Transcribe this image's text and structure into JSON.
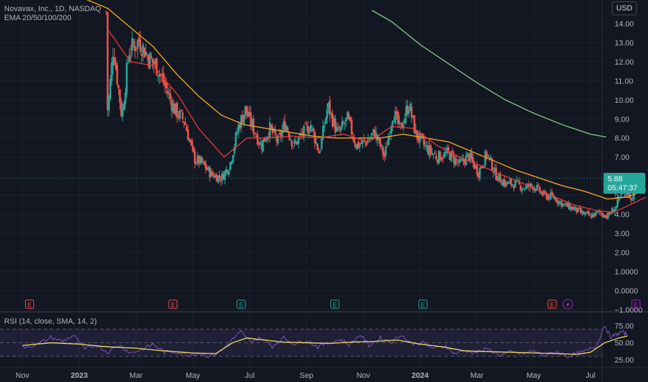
{
  "header": {
    "symbol_line": "Novavax, Inc., 1D, NASDAQ",
    "indicator_line": "EMA 20/50/100/200",
    "currency_button": "USD"
  },
  "rsi_panel": {
    "label": "RSI (14, close, SMA, 14, 2)"
  },
  "price_tag": {
    "price": "5.88",
    "countdown": "05:47:37"
  },
  "colors": {
    "background": "#131722",
    "up": "#26a69a",
    "down": "#ef5350",
    "ema20": "#e53935",
    "ema50": "#f5a623",
    "ema200": "#81c784",
    "rsi": "#7e57c2",
    "rsi_ma": "#e6d55a",
    "grid": "#1e222d"
  },
  "chart_data": [
    {
      "type": "candlestick",
      "title": "Novavax, Inc., 1D, NASDAQ",
      "y_ticks": [
        "14.00",
        "13.00",
        "12.00",
        "11.00",
        "10.00",
        "9.00",
        "8.00",
        "7.00",
        "6.00",
        "5.00",
        "4.00",
        "3.00",
        "2.00",
        "1.0000",
        "0.0000",
        "−1.0000"
      ],
      "ylim": [
        -1.0,
        14.7
      ],
      "x_ticks": [
        "Nov",
        "2023",
        "Mar",
        "May",
        "Jul",
        "Sep",
        "Nov",
        "2024",
        "Mar",
        "May",
        "Jul"
      ],
      "bold_x_ticks": [
        "2023",
        "2024"
      ],
      "x_tick_months": [
        0,
        2,
        4,
        6,
        8,
        10,
        12,
        14,
        16,
        18,
        20
      ],
      "xlim_months": [
        -0.4,
        20.8
      ],
      "legend": "EMA 20/50/100/200",
      "grid": true,
      "price_anchors": [
        [
          2.95,
          14.6
        ],
        [
          3.0,
          9.3
        ],
        [
          3.2,
          12.8
        ],
        [
          3.5,
          9.1
        ],
        [
          3.75,
          12.6
        ],
        [
          4.1,
          13.1
        ],
        [
          4.45,
          12.2
        ],
        [
          4.75,
          11.7
        ],
        [
          5.0,
          10.8
        ],
        [
          5.35,
          9.5
        ],
        [
          5.7,
          8.9
        ],
        [
          6.05,
          6.9
        ],
        [
          6.3,
          6.7
        ],
        [
          6.65,
          6.1
        ],
        [
          7.0,
          5.9
        ],
        [
          7.3,
          6.6
        ],
        [
          7.6,
          8.6
        ],
        [
          7.85,
          9.5
        ],
        [
          8.1,
          8.6
        ],
        [
          8.4,
          7.6
        ],
        [
          8.7,
          8.5
        ],
        [
          9.0,
          7.8
        ],
        [
          9.25,
          8.8
        ],
        [
          9.55,
          7.6
        ],
        [
          9.85,
          8.2
        ],
        [
          10.15,
          8.7
        ],
        [
          10.45,
          7.2
        ],
        [
          10.75,
          9.7
        ],
        [
          11.1,
          8.2
        ],
        [
          11.45,
          9.0
        ],
        [
          11.75,
          7.6
        ],
        [
          12.1,
          7.8
        ],
        [
          12.4,
          8.3
        ],
        [
          12.75,
          7.0
        ],
        [
          13.05,
          9.4
        ],
        [
          13.3,
          8.4
        ],
        [
          13.6,
          9.8
        ],
        [
          13.85,
          8.2
        ],
        [
          14.2,
          7.5
        ],
        [
          14.6,
          7.0
        ],
        [
          15.0,
          7.2
        ],
        [
          15.4,
          6.6
        ],
        [
          15.7,
          7.1
        ],
        [
          16.05,
          6.2
        ],
        [
          16.35,
          7.2
        ],
        [
          16.65,
          6.1
        ],
        [
          17.0,
          5.6
        ],
        [
          17.35,
          5.6
        ],
        [
          17.65,
          5.4
        ],
        [
          18.0,
          5.5
        ],
        [
          18.35,
          5.0
        ],
        [
          18.7,
          4.9
        ],
        [
          19.05,
          4.5
        ],
        [
          19.4,
          4.3
        ],
        [
          19.7,
          4.05
        ],
        [
          20.0,
          3.9
        ],
        [
          20.3,
          4.1
        ],
        [
          20.6,
          3.9
        ],
        [
          20.9,
          4.4
        ],
        [
          21.2,
          5.4
        ],
        [
          21.45,
          4.8
        ],
        [
          21.7,
          5.9
        ],
        [
          21.95,
          5.88
        ]
      ],
      "ema20_points": [
        [
          3.05,
          13.6
        ],
        [
          3.8,
          12.0
        ],
        [
          4.6,
          11.8
        ],
        [
          5.5,
          10.2
        ],
        [
          6.2,
          8.5
        ],
        [
          7.1,
          7.0
        ],
        [
          7.9,
          8.0
        ],
        [
          8.6,
          8.0
        ],
        [
          9.5,
          8.1
        ],
        [
          10.4,
          8.0
        ],
        [
          11.3,
          8.2
        ],
        [
          12.2,
          7.8
        ],
        [
          13.0,
          8.6
        ],
        [
          13.8,
          8.5
        ],
        [
          14.6,
          7.6
        ],
        [
          15.4,
          7.0
        ],
        [
          16.2,
          6.5
        ],
        [
          17.0,
          6.0
        ],
        [
          17.8,
          5.5
        ],
        [
          18.6,
          5.0
        ],
        [
          19.4,
          4.5
        ],
        [
          20.2,
          4.2
        ],
        [
          20.8,
          4.1
        ],
        [
          21.4,
          4.5
        ],
        [
          21.95,
          4.9
        ]
      ],
      "ema50_points": [
        [
          0.0,
          18.4
        ],
        [
          1.0,
          17.2
        ],
        [
          2.0,
          16.0
        ],
        [
          3.0,
          14.8
        ],
        [
          3.8,
          13.8
        ],
        [
          4.6,
          12.8
        ],
        [
          5.4,
          11.4
        ],
        [
          6.2,
          10.2
        ],
        [
          7.0,
          9.2
        ],
        [
          7.8,
          8.7
        ],
        [
          8.6,
          8.5
        ],
        [
          9.4,
          8.3
        ],
        [
          10.2,
          8.1
        ],
        [
          11.0,
          8.0
        ],
        [
          11.8,
          8.0
        ],
        [
          12.6,
          8.0
        ],
        [
          13.4,
          8.2
        ],
        [
          14.2,
          8.0
        ],
        [
          15.0,
          7.8
        ],
        [
          15.8,
          7.3
        ],
        [
          16.6,
          6.8
        ],
        [
          17.4,
          6.3
        ],
        [
          18.2,
          5.9
        ],
        [
          19.0,
          5.5
        ],
        [
          19.8,
          5.2
        ],
        [
          20.6,
          4.8
        ],
        [
          21.3,
          4.9
        ],
        [
          21.95,
          5.3
        ]
      ],
      "ema200_points": [
        [
          12.3,
          14.7
        ],
        [
          13.0,
          14.1
        ],
        [
          14.0,
          12.9
        ],
        [
          15.0,
          11.9
        ],
        [
          16.0,
          10.9
        ],
        [
          17.0,
          10.0
        ],
        [
          18.0,
          9.3
        ],
        [
          19.0,
          8.7
        ],
        [
          20.0,
          8.2
        ],
        [
          20.55,
          8.05
        ]
      ],
      "earnings_markers": [
        {
          "month": 0.25,
          "label": "E",
          "kind": "down"
        },
        {
          "month": 5.3,
          "label": "E",
          "kind": "down"
        },
        {
          "month": 7.7,
          "label": "E",
          "kind": "up"
        },
        {
          "month": 11.0,
          "label": "E",
          "kind": "up"
        },
        {
          "month": 14.1,
          "label": "E",
          "kind": "up"
        },
        {
          "month": 18.65,
          "label": "E",
          "kind": "down"
        },
        {
          "month": 21.6,
          "label": "E",
          "kind": "future"
        }
      ],
      "dividend_marker": {
        "month": 19.2,
        "label": "⚡"
      }
    },
    {
      "type": "line",
      "title": "RSI (14, close, SMA, 14, 2)",
      "y_ticks": [
        "75.00",
        "50.00",
        "25.00"
      ],
      "ylim": [
        18,
        83
      ],
      "upper_band": 70,
      "middle_band": 50,
      "lower_band": 30,
      "series": [
        {
          "name": "RSI",
          "points": [
            [
              0.0,
              44
            ],
            [
              0.5,
              47
            ],
            [
              1.0,
              58
            ],
            [
              1.4,
              52
            ],
            [
              1.8,
              61
            ],
            [
              2.2,
              40
            ],
            [
              2.6,
              47
            ],
            [
              3.0,
              36
            ],
            [
              3.4,
              47
            ],
            [
              3.8,
              35
            ],
            [
              4.2,
              40
            ],
            [
              4.6,
              48
            ],
            [
              5.0,
              36
            ],
            [
              5.4,
              37
            ],
            [
              5.8,
              32
            ],
            [
              6.2,
              35
            ],
            [
              6.6,
              30
            ],
            [
              7.0,
              38
            ],
            [
              7.4,
              55
            ],
            [
              7.7,
              66
            ],
            [
              8.0,
              52
            ],
            [
              8.4,
              57
            ],
            [
              8.8,
              45
            ],
            [
              9.2,
              57
            ],
            [
              9.6,
              48
            ],
            [
              10.0,
              54
            ],
            [
              10.4,
              44
            ],
            [
              10.8,
              50
            ],
            [
              11.2,
              55
            ],
            [
              11.5,
              47
            ],
            [
              11.9,
              62
            ],
            [
              12.2,
              46
            ],
            [
              12.6,
              57
            ],
            [
              13.0,
              51
            ],
            [
              13.3,
              62
            ],
            [
              13.7,
              49
            ],
            [
              14.1,
              50
            ],
            [
              14.5,
              41
            ],
            [
              14.9,
              46
            ],
            [
              15.2,
              34
            ],
            [
              15.6,
              38
            ],
            [
              16.0,
              36
            ],
            [
              16.4,
              41
            ],
            [
              16.8,
              32
            ],
            [
              17.2,
              36
            ],
            [
              17.6,
              34
            ],
            [
              18.0,
              38
            ],
            [
              18.4,
              31
            ],
            [
              18.8,
              37
            ],
            [
              19.2,
              30
            ],
            [
              19.5,
              34
            ],
            [
              19.8,
              37
            ],
            [
              20.2,
              45
            ],
            [
              20.5,
              76
            ],
            [
              20.7,
              58
            ],
            [
              20.9,
              62
            ],
            [
              21.1,
              66
            ],
            [
              21.3,
              62
            ]
          ]
        },
        {
          "name": "RSI-based MA",
          "points": [
            [
              0.0,
              46
            ],
            [
              1.0,
              50
            ],
            [
              2.0,
              48
            ],
            [
              3.0,
              44
            ],
            [
              4.0,
              42
            ],
            [
              5.0,
              38
            ],
            [
              6.0,
              35
            ],
            [
              6.8,
              34
            ],
            [
              7.4,
              50
            ],
            [
              7.9,
              57
            ],
            [
              8.5,
              54
            ],
            [
              9.2,
              51
            ],
            [
              10.0,
              50
            ],
            [
              10.8,
              49
            ],
            [
              11.6,
              51
            ],
            [
              12.4,
              52
            ],
            [
              13.2,
              54
            ],
            [
              14.0,
              48
            ],
            [
              14.8,
              44
            ],
            [
              15.6,
              38
            ],
            [
              16.4,
              37
            ],
            [
              17.2,
              36
            ],
            [
              18.0,
              35
            ],
            [
              18.8,
              34
            ],
            [
              19.5,
              33
            ],
            [
              20.0,
              36
            ],
            [
              20.5,
              50
            ],
            [
              21.0,
              57
            ],
            [
              21.3,
              60
            ]
          ]
        }
      ]
    }
  ]
}
